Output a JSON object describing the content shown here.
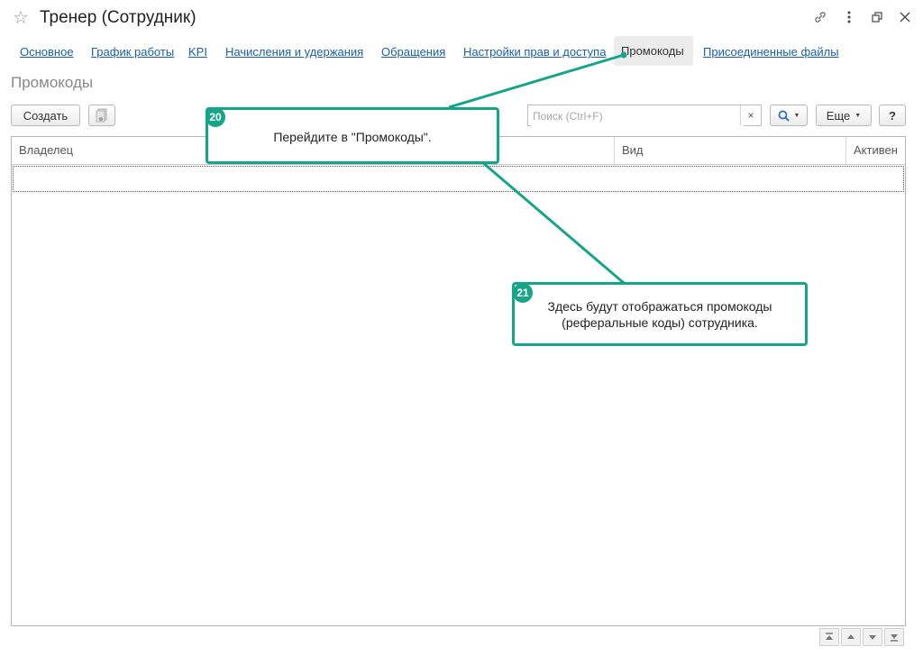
{
  "window": {
    "title": "Тренер (Сотрудник)",
    "icons": [
      "star-icon",
      "link-icon",
      "more-icon",
      "restore-icon",
      "close-icon"
    ]
  },
  "tabs": [
    {
      "label": "Основное"
    },
    {
      "label": "График работы"
    },
    {
      "label": "KPI"
    },
    {
      "label": "Начисления и удержания"
    },
    {
      "label": "Обращения"
    },
    {
      "label": "Настройки прав и доступа"
    },
    {
      "label": "Промокоды",
      "active": true
    },
    {
      "label": "Присоединенные файлы"
    }
  ],
  "section_title": "Промокоды",
  "toolbar": {
    "create_label": "Создать",
    "search_placeholder": "Поиск (Ctrl+F)",
    "search_clear": "×",
    "more_label": "Еще",
    "help_label": "?"
  },
  "table": {
    "columns": [
      "Владелец",
      "Вид",
      "Активен"
    ],
    "rows": []
  },
  "callouts": [
    {
      "number": "20",
      "text": "Перейдите в \"Промокоды\"."
    },
    {
      "number": "21",
      "text_line1": "Здесь будут отображаться промокоды",
      "text_line2": "(реферальные коды) сотрудника."
    }
  ],
  "colors": {
    "accent": "#17a589",
    "link": "#1a5ea8",
    "search_icon": "#2f6fbf"
  }
}
